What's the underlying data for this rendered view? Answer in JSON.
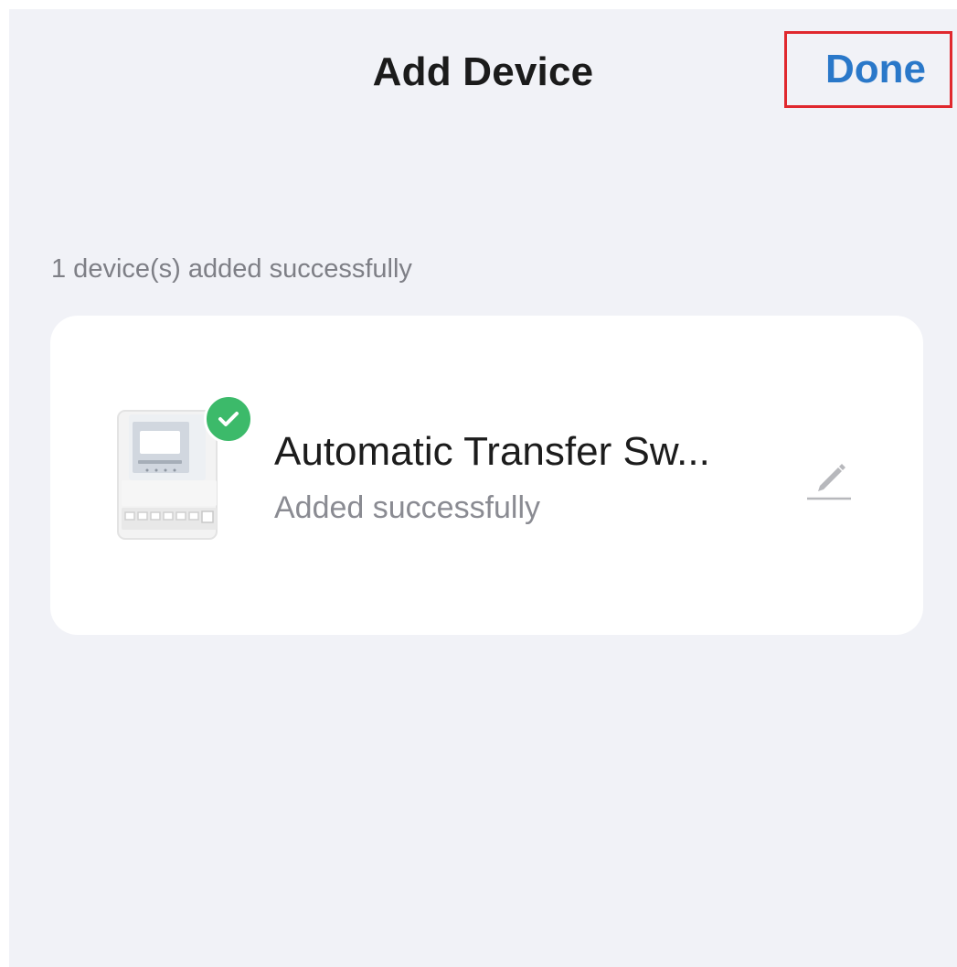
{
  "header": {
    "title": "Add Device",
    "done_label": "Done"
  },
  "summary": {
    "text": "1 device(s) added successfully"
  },
  "device": {
    "name": "Automatic Transfer Sw...",
    "status": "Added successfully",
    "icon": "device-thumbnail",
    "status_icon": "check-icon",
    "edit_icon": "pencil-icon"
  },
  "colors": {
    "background": "#f1f2f7",
    "accent": "#2a78c9",
    "success": "#3cba6a",
    "highlight": "#e0282e"
  }
}
